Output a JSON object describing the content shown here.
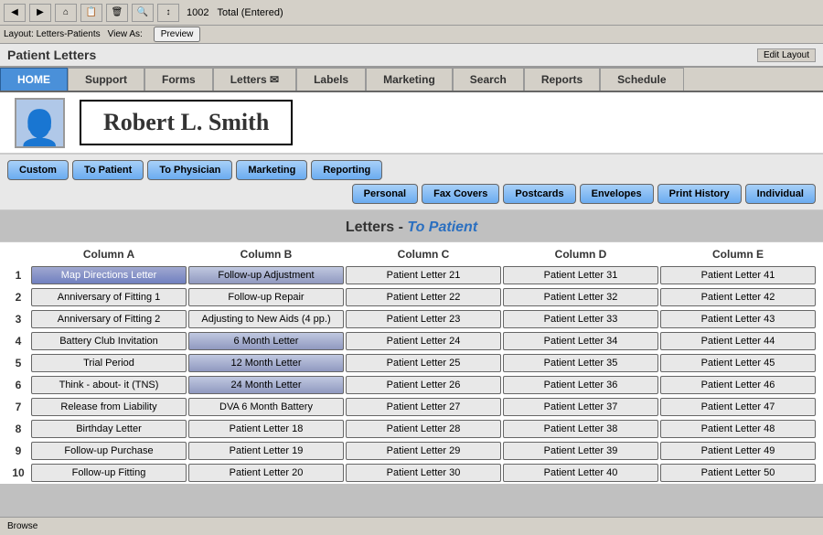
{
  "appTitle": "Patient Letters",
  "editLayout": "Edit Layout",
  "toolbar": {
    "recordInfo": "1002",
    "totalLabel": "Total (Entered)"
  },
  "layoutBar": {
    "layout": "Layout: Letters-Patients",
    "viewAs": "View As:"
  },
  "navTabs": [
    {
      "label": "HOME",
      "active": true
    },
    {
      "label": "Support"
    },
    {
      "label": "Forms"
    },
    {
      "label": "Letters ✉"
    },
    {
      "label": "Labels"
    },
    {
      "label": "Marketing"
    },
    {
      "label": "Search"
    },
    {
      "label": "Reports"
    },
    {
      "label": "Schedule"
    }
  ],
  "patient": {
    "name": "Robert L. Smith"
  },
  "leftBtnTabs": [
    "Custom",
    "To Patient",
    "To Physician",
    "Marketing",
    "Reporting"
  ],
  "rightBtnTabs": [
    "Personal",
    "Fax Covers",
    "Postcards",
    "Envelopes",
    "Print History",
    "Individual"
  ],
  "sectionTitle": "Letters - ",
  "sectionTitleItalic": "To Patient",
  "columnHeaders": [
    "Column A",
    "Column B",
    "Column C",
    "Column D",
    "Column E"
  ],
  "rows": [
    {
      "num": 1,
      "a": "Map Directions Letter",
      "b": "Follow-up Adjustment",
      "c": "Patient Letter 21",
      "d": "Patient Letter 31",
      "e": "Patient Letter 41",
      "aHighlight": true,
      "bBlueGray": true
    },
    {
      "num": 2,
      "a": "Anniversary of Fitting 1",
      "b": "Follow-up Repair",
      "c": "Patient Letter 22",
      "d": "Patient Letter 32",
      "e": "Patient Letter 42"
    },
    {
      "num": 3,
      "a": "Anniversary of Fitting 2",
      "b": "Adjusting to New Aids (4 pp.)",
      "c": "Patient Letter 23",
      "d": "Patient Letter 33",
      "e": "Patient Letter 43"
    },
    {
      "num": 4,
      "a": "Battery Club Invitation",
      "b": "6 Month Letter",
      "c": "Patient Letter 24",
      "d": "Patient Letter 34",
      "e": "Patient Letter 44",
      "bBlueGray": true
    },
    {
      "num": 5,
      "a": "Trial Period",
      "b": "12 Month Letter",
      "c": "Patient Letter 25",
      "d": "Patient Letter 35",
      "e": "Patient Letter 45",
      "bBlueGray": true
    },
    {
      "num": 6,
      "a": "Think - about- it (TNS)",
      "b": "24 Month Letter",
      "c": "Patient Letter 26",
      "d": "Patient Letter 36",
      "e": "Patient Letter 46",
      "bBlueGray": true
    },
    {
      "num": 7,
      "a": "Release from Liability",
      "b": "DVA 6 Month Battery",
      "c": "Patient Letter 27",
      "d": "Patient Letter 37",
      "e": "Patient Letter 47"
    },
    {
      "num": 8,
      "a": "Birthday Letter",
      "b": "Patient Letter 18",
      "c": "Patient Letter 28",
      "d": "Patient Letter 38",
      "e": "Patient Letter 48"
    },
    {
      "num": 9,
      "a": "Follow-up Purchase",
      "b": "Patient Letter 19",
      "c": "Patient Letter 29",
      "d": "Patient Letter 39",
      "e": "Patient Letter 49"
    },
    {
      "num": 10,
      "a": "Follow-up Fitting",
      "b": "Patient Letter 20",
      "c": "Patient Letter 30",
      "d": "Patient Letter 40",
      "e": "Patient Letter 50"
    }
  ],
  "statusBar": "Browse"
}
